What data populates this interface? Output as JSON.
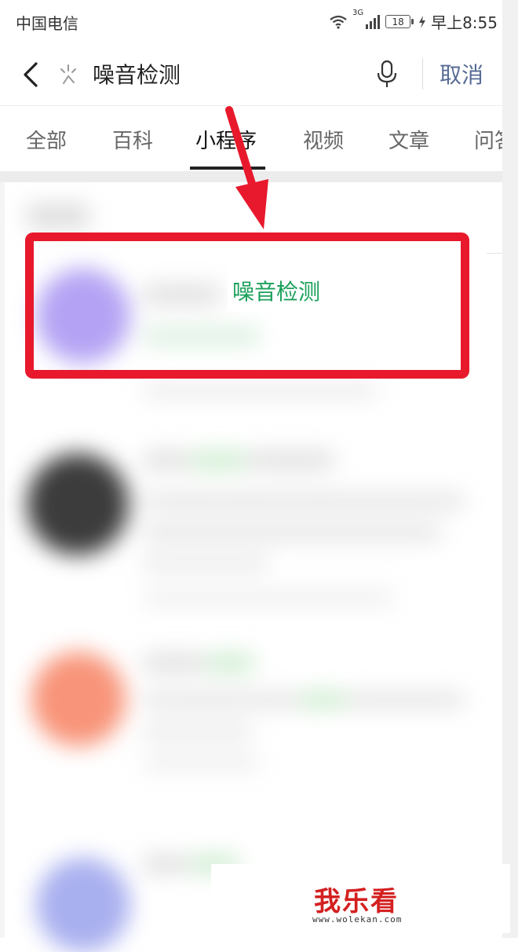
{
  "status_bar": {
    "carrier": "中国电信",
    "network": "3G",
    "battery": "18",
    "time": "早上8:55"
  },
  "search": {
    "query": "噪音检测",
    "cancel_label": "取消"
  },
  "tabs": [
    {
      "label": "全部"
    },
    {
      "label": "百科"
    },
    {
      "label": "小程序"
    },
    {
      "label": "视频"
    },
    {
      "label": "文章"
    },
    {
      "label": "问答"
    }
  ],
  "active_tab": "小程序",
  "results": {
    "first_title_visible": "噪音检测"
  },
  "watermark": {
    "title": "我乐看",
    "url": "www.wolekan.com"
  },
  "colors": {
    "highlight": "#e8192c",
    "match_text": "#19a05a",
    "cancel": "#576b95"
  },
  "icons": [
    "back-arrow-icon",
    "loading-spinner-icon",
    "microphone-icon",
    "wifi-icon",
    "signal-icon",
    "battery-icon",
    "charging-icon"
  ]
}
